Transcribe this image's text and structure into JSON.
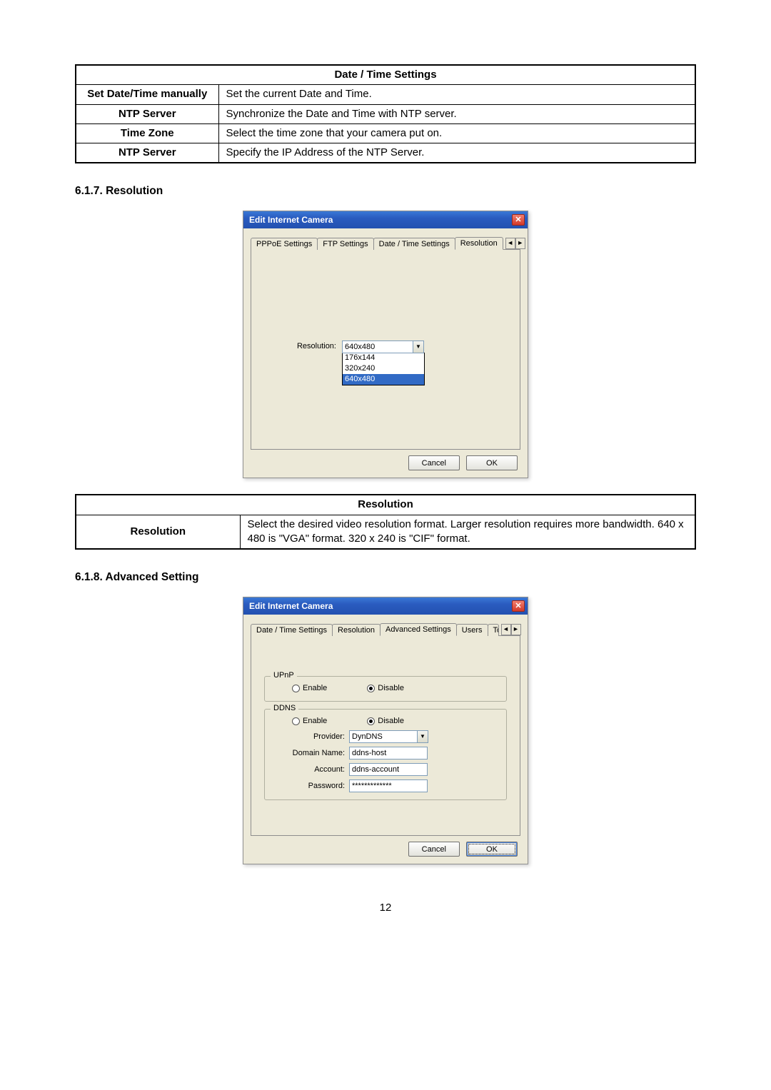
{
  "tables": {
    "datetime": {
      "header": "Date / Time Settings",
      "rows": [
        {
          "label": "Set Date/Time manually",
          "desc": "Set the current Date and Time."
        },
        {
          "label": "NTP Server",
          "desc": "Synchronize the Date and Time with NTP server."
        },
        {
          "label": "Time Zone",
          "desc": "Select the time zone that your camera put on."
        },
        {
          "label": "NTP Server",
          "desc": "Specify the IP Address of the NTP Server."
        }
      ]
    },
    "resolution": {
      "header": "Resolution",
      "rows": [
        {
          "label": "Resolution",
          "desc": "Select the desired video resolution format. Larger resolution requires more bandwidth. 640 x 480 is \"VGA\" format. 320 x 240 is \"CIF\" format."
        }
      ]
    }
  },
  "sections": {
    "res_heading": "6.1.7.   Resolution",
    "adv_heading": "6.1.8.   Advanced Setting"
  },
  "dialog": {
    "title": "Edit Internet Camera",
    "close_glyph": "✕",
    "cancel": "Cancel",
    "ok": "OK",
    "arrow_left": "◄",
    "arrow_right": "►"
  },
  "res_dialog": {
    "tabs": [
      "PPPoE Settings",
      "FTP Settings",
      "Date / Time Settings",
      "Resolution"
    ],
    "active_tab": 3,
    "label": "Resolution:",
    "value": "640x480",
    "options": [
      "176x144",
      "320x240",
      "640x480"
    ],
    "selected_option": 2
  },
  "adv_dialog": {
    "tabs": [
      "Date / Time Settings",
      "Resolution",
      "Advanced Settings",
      "Users",
      "To"
    ],
    "active_tab": 2,
    "upnp": {
      "legend": "UPnP",
      "enable": "Enable",
      "disable": "Disable",
      "selected": "disable"
    },
    "ddns": {
      "legend": "DDNS",
      "enable": "Enable",
      "disable": "Disable",
      "selected": "disable",
      "provider_label": "Provider:",
      "provider_value": "DynDNS",
      "domain_label": "Domain Name:",
      "domain_value": "ddns-host",
      "account_label": "Account:",
      "account_value": "ddns-account",
      "password_label": "Password:",
      "password_value": "*************"
    }
  },
  "page_number": "12"
}
